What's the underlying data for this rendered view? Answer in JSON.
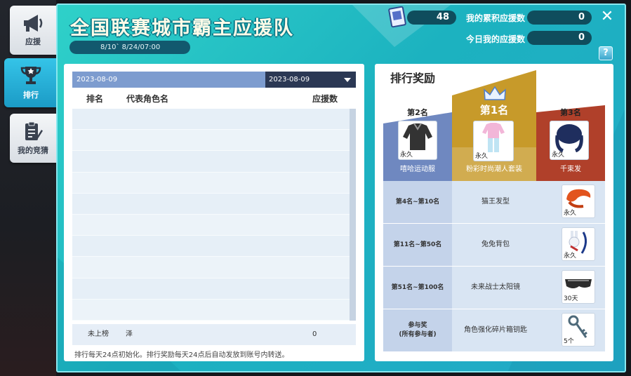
{
  "sidebar": {
    "tabs": [
      {
        "label": "应援",
        "icon": "megaphone-icon"
      },
      {
        "label": "排行",
        "icon": "trophy-icon",
        "active": true
      },
      {
        "label": "我的竞猜",
        "icon": "clipboard-icon"
      }
    ]
  },
  "header": {
    "title": "全国联赛城市霸主应援队",
    "period": "8/10` 8/24/07:00",
    "ticket_count": "48",
    "my_total_label": "我的累积应援数",
    "my_total_value": "0",
    "today_label": "今日我的应援数",
    "today_value": "0",
    "close_label": "✕",
    "help_label": "?"
  },
  "ranking": {
    "date_from": "2023-08-09",
    "date_select": "2023-08-09",
    "columns": {
      "rank": "排名",
      "character": "代表角色名",
      "count": "应援数"
    },
    "my_row": {
      "rank": "未上榜",
      "name": "泽",
      "count": "0"
    },
    "note": "排行每天24点初始化。排行奖励每天24点后自动发放到账号内转送。"
  },
  "rewards": {
    "title": "排行奖励",
    "podium": [
      {
        "rank": "第2名",
        "item": "嘻哈运动服",
        "duration": "永久"
      },
      {
        "rank": "第1名",
        "item": "粉彩时尚潮人套装",
        "duration": "永久"
      },
      {
        "rank": "第3名",
        "item": "千束发",
        "duration": "永久"
      }
    ],
    "tiers": [
      {
        "rank": "第4名~第10名",
        "item": "猫王发型",
        "duration": "永久"
      },
      {
        "rank": "第11名~第50名",
        "item": "兔兔背包",
        "duration": "永久"
      },
      {
        "rank": "第51名~第100名",
        "item": "未来战士太阳镜",
        "duration": "30天"
      },
      {
        "rank_line1": "参与奖",
        "rank_line2": "(所有参与者)",
        "item": "角色强化碎片箱钥匙",
        "duration": "5个"
      }
    ]
  },
  "colors": {
    "panel_teal": "#1cb2c0",
    "gold": "#c79a2a",
    "silver_blue": "#6f88c0",
    "bronze_red": "#b0402a"
  }
}
